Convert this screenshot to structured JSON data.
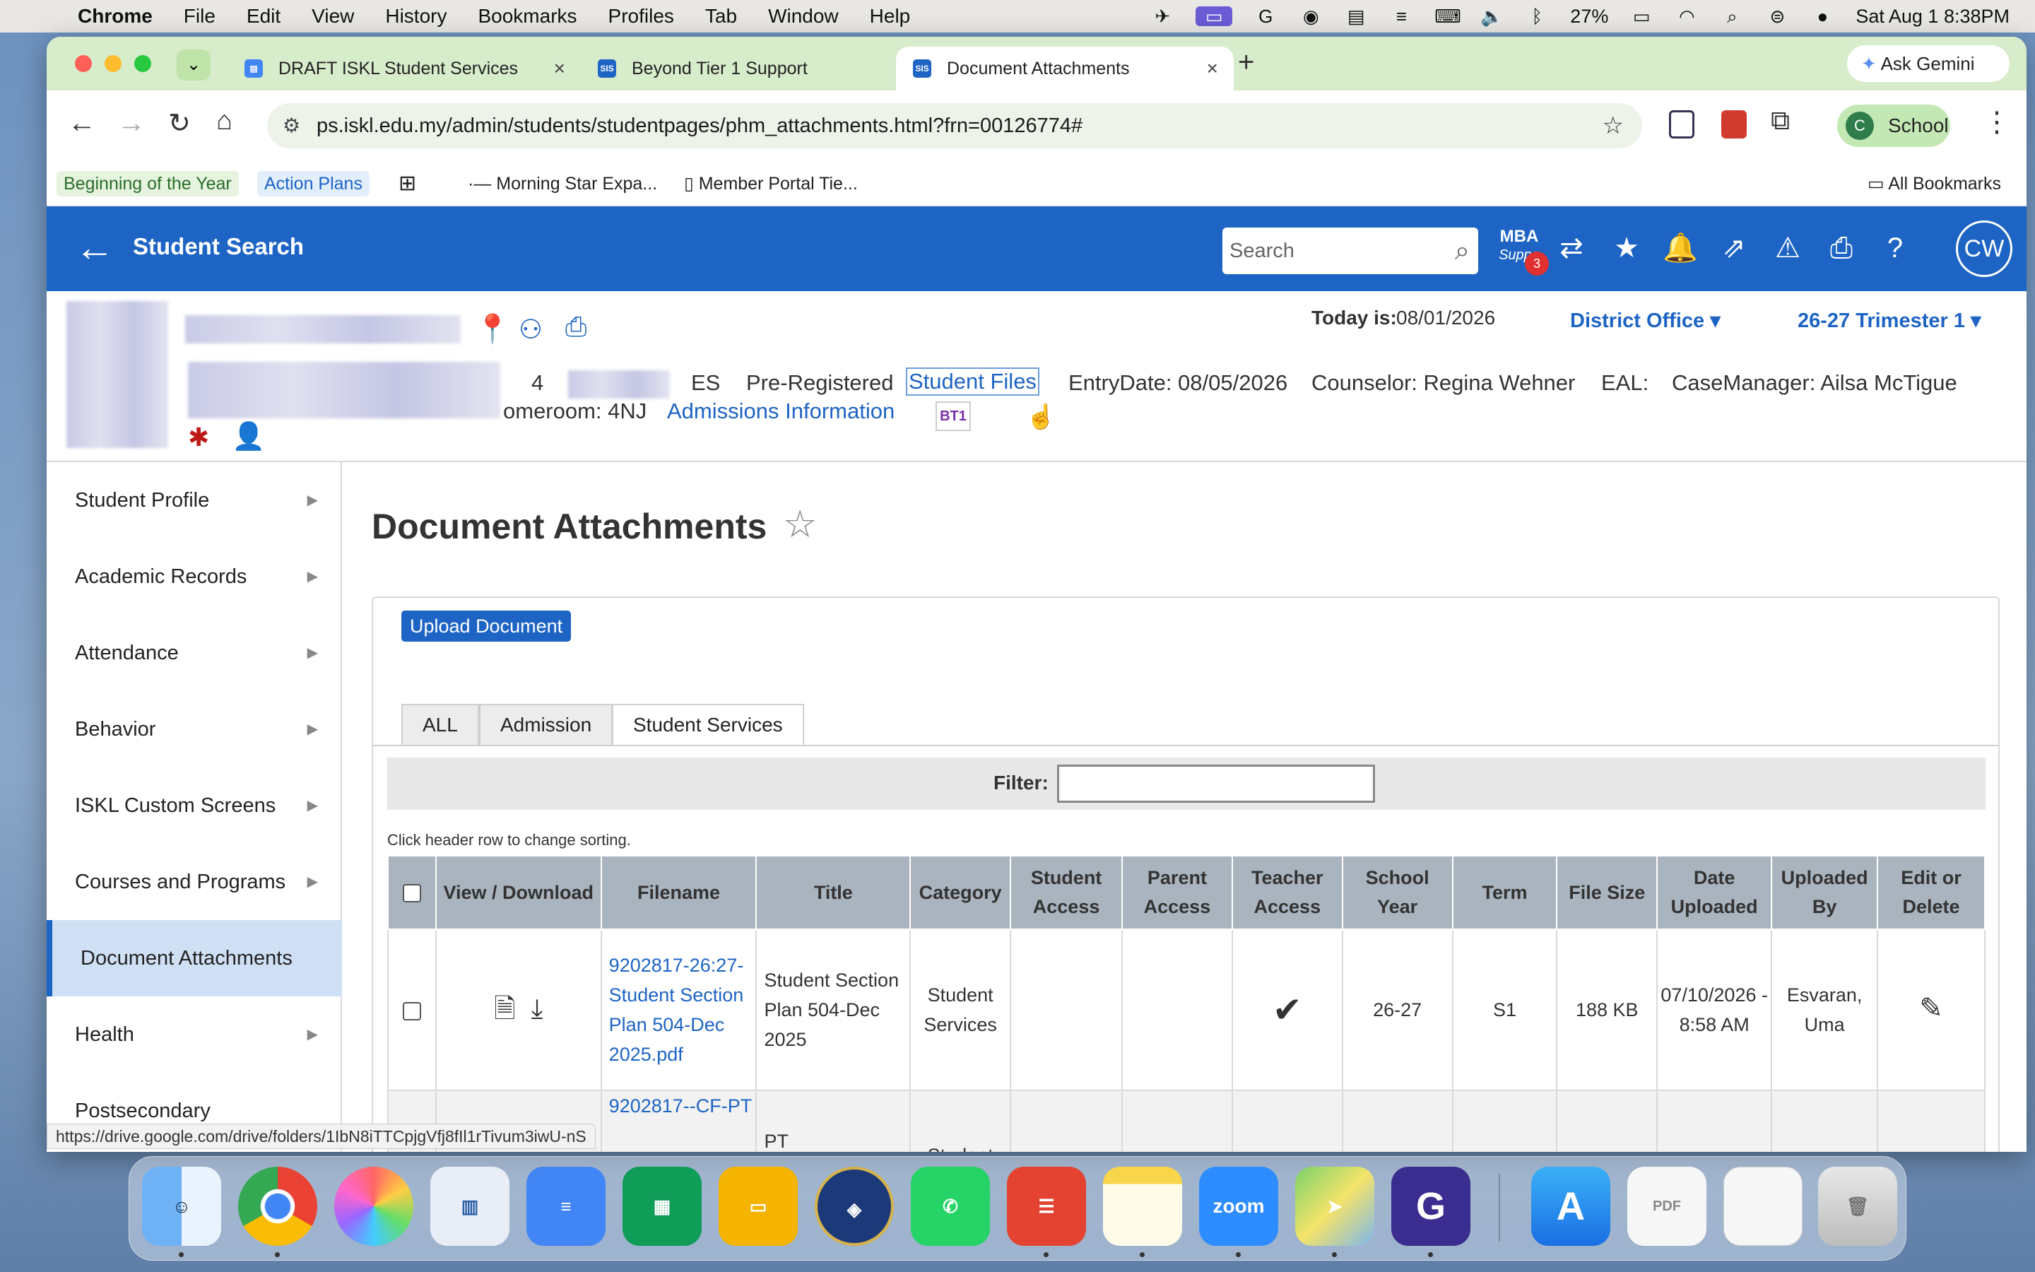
{
  "menubar": {
    "app": "Chrome",
    "items": [
      "File",
      "Edit",
      "View",
      "History",
      "Bookmarks",
      "Profiles",
      "Tab",
      "Window",
      "Help"
    ],
    "battery": "27%",
    "datetime": "Sat Aug 1  8:38PM"
  },
  "browser": {
    "tabs": [
      {
        "title": "DRAFT ISKL Student Services",
        "favicon": "docs-icon"
      },
      {
        "title": "Beyond Tier 1 Support",
        "favicon": "sis-icon"
      },
      {
        "title": "Document Attachments",
        "favicon": "sis-icon"
      }
    ],
    "ask_gemini": "Ask Gemini",
    "url": "ps.iskl.edu.my/admin/students/studentpages/phm_attachments.html?frn=00126774#",
    "profile_label": "School",
    "profile_initial": "C",
    "bookmarks": [
      "Beginning of the Year",
      "Action Plans",
      "Morning Star Expa...",
      "Member Portal Tie..."
    ],
    "all_bookmarks": "All Bookmarks"
  },
  "app": {
    "back_title": "Student Search",
    "search_placeholder": "Search",
    "mba_label": "MBA",
    "mba_sub": "Suppo",
    "mba_badge": "3",
    "avatar": "CW"
  },
  "student": {
    "today_label": "Today is:",
    "today": "08/01/2026",
    "district": "District Office",
    "term": "26-27 Trimester 1",
    "grade": "4",
    "school": "ES",
    "status": "Pre-Registered",
    "student_files": "Student Files",
    "entry": "EntryDate: 08/05/2026",
    "counselor": "Counselor: Regina Wehner",
    "eal": "EAL:",
    "case_manager": "CaseManager: Ailsa McTigue",
    "homeroom": "omeroom: 4NJ",
    "admissions": "Admissions Information",
    "bt1": "BT1"
  },
  "sidebar": {
    "items": [
      {
        "label": "Student Profile"
      },
      {
        "label": "Academic Records"
      },
      {
        "label": "Attendance"
      },
      {
        "label": "Behavior"
      },
      {
        "label": "ISKL Custom Screens"
      },
      {
        "label": "Courses and Programs"
      },
      {
        "label": "Document Attachments"
      },
      {
        "label": "Health"
      },
      {
        "label": "Postsecondary"
      }
    ]
  },
  "main": {
    "title": "Document Attachments",
    "upload": "Upload Document",
    "tabs": [
      "ALL",
      "Admission",
      "Student Services"
    ],
    "filter_label": "Filter:",
    "hint": "Click header row to change sorting.",
    "columns": [
      "View / Download",
      "Filename",
      "Title",
      "Category",
      "Student Access",
      "Parent Access",
      "Teacher Access",
      "School Year",
      "Term",
      "File Size",
      "Date Uploaded",
      "Uploaded By",
      "Edit or Delete"
    ],
    "rows": [
      {
        "filename": "9202817-26:27-Student Section Plan 504-Dec 2025.pdf",
        "title": "Student Section Plan 504-Dec 2025",
        "category": "Student Services",
        "student_access": "",
        "parent_access": "",
        "teacher_access": "✔",
        "year": "26-27",
        "term": "S1",
        "size": "188 KB",
        "date": "07/10/2026 - 8:58 AM",
        "by": "Esvaran, Uma"
      },
      {
        "filename": "9202817--CF-PT",
        "title": "PT",
        "category": "Student",
        "student_access": "",
        "parent_access": "",
        "teacher_access": "",
        "year": "",
        "term": "",
        "size": "",
        "date": "",
        "by": ""
      }
    ]
  },
  "status_url": "https://drive.google.com/drive/folders/1IbN8iTTCpjgVfj8fIl1rTivum3iwU-nS",
  "dock": [
    "Finder",
    "Chrome",
    "Photos",
    "Keynote",
    "Docs",
    "Sheets",
    "Slides",
    "ISKL",
    "WhatsApp",
    "Todoist",
    "Notes",
    "Zoom",
    "Maps",
    "Grammarly",
    "App Store",
    "Preview",
    "Chrome Window",
    "Trash"
  ]
}
